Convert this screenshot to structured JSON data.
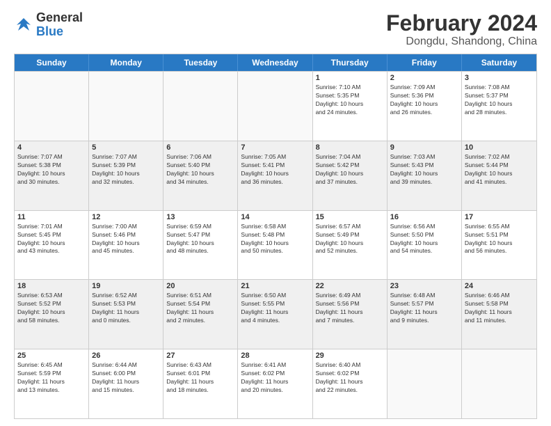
{
  "logo": {
    "text_general": "General",
    "text_blue": "Blue"
  },
  "header": {
    "month": "February 2024",
    "location": "Dongdu, Shandong, China"
  },
  "weekdays": [
    "Sunday",
    "Monday",
    "Tuesday",
    "Wednesday",
    "Thursday",
    "Friday",
    "Saturday"
  ],
  "rows": [
    [
      {
        "day": "",
        "text": "",
        "empty": true
      },
      {
        "day": "",
        "text": "",
        "empty": true
      },
      {
        "day": "",
        "text": "",
        "empty": true
      },
      {
        "day": "",
        "text": "",
        "empty": true
      },
      {
        "day": "1",
        "text": "Sunrise: 7:10 AM\nSunset: 5:35 PM\nDaylight: 10 hours\nand 24 minutes."
      },
      {
        "day": "2",
        "text": "Sunrise: 7:09 AM\nSunset: 5:36 PM\nDaylight: 10 hours\nand 26 minutes."
      },
      {
        "day": "3",
        "text": "Sunrise: 7:08 AM\nSunset: 5:37 PM\nDaylight: 10 hours\nand 28 minutes."
      }
    ],
    [
      {
        "day": "4",
        "text": "Sunrise: 7:07 AM\nSunset: 5:38 PM\nDaylight: 10 hours\nand 30 minutes.",
        "shaded": true
      },
      {
        "day": "5",
        "text": "Sunrise: 7:07 AM\nSunset: 5:39 PM\nDaylight: 10 hours\nand 32 minutes.",
        "shaded": true
      },
      {
        "day": "6",
        "text": "Sunrise: 7:06 AM\nSunset: 5:40 PM\nDaylight: 10 hours\nand 34 minutes.",
        "shaded": true
      },
      {
        "day": "7",
        "text": "Sunrise: 7:05 AM\nSunset: 5:41 PM\nDaylight: 10 hours\nand 36 minutes.",
        "shaded": true
      },
      {
        "day": "8",
        "text": "Sunrise: 7:04 AM\nSunset: 5:42 PM\nDaylight: 10 hours\nand 37 minutes.",
        "shaded": true
      },
      {
        "day": "9",
        "text": "Sunrise: 7:03 AM\nSunset: 5:43 PM\nDaylight: 10 hours\nand 39 minutes.",
        "shaded": true
      },
      {
        "day": "10",
        "text": "Sunrise: 7:02 AM\nSunset: 5:44 PM\nDaylight: 10 hours\nand 41 minutes.",
        "shaded": true
      }
    ],
    [
      {
        "day": "11",
        "text": "Sunrise: 7:01 AM\nSunset: 5:45 PM\nDaylight: 10 hours\nand 43 minutes."
      },
      {
        "day": "12",
        "text": "Sunrise: 7:00 AM\nSunset: 5:46 PM\nDaylight: 10 hours\nand 45 minutes."
      },
      {
        "day": "13",
        "text": "Sunrise: 6:59 AM\nSunset: 5:47 PM\nDaylight: 10 hours\nand 48 minutes."
      },
      {
        "day": "14",
        "text": "Sunrise: 6:58 AM\nSunset: 5:48 PM\nDaylight: 10 hours\nand 50 minutes."
      },
      {
        "day": "15",
        "text": "Sunrise: 6:57 AM\nSunset: 5:49 PM\nDaylight: 10 hours\nand 52 minutes."
      },
      {
        "day": "16",
        "text": "Sunrise: 6:56 AM\nSunset: 5:50 PM\nDaylight: 10 hours\nand 54 minutes."
      },
      {
        "day": "17",
        "text": "Sunrise: 6:55 AM\nSunset: 5:51 PM\nDaylight: 10 hours\nand 56 minutes."
      }
    ],
    [
      {
        "day": "18",
        "text": "Sunrise: 6:53 AM\nSunset: 5:52 PM\nDaylight: 10 hours\nand 58 minutes.",
        "shaded": true
      },
      {
        "day": "19",
        "text": "Sunrise: 6:52 AM\nSunset: 5:53 PM\nDaylight: 11 hours\nand 0 minutes.",
        "shaded": true
      },
      {
        "day": "20",
        "text": "Sunrise: 6:51 AM\nSunset: 5:54 PM\nDaylight: 11 hours\nand 2 minutes.",
        "shaded": true
      },
      {
        "day": "21",
        "text": "Sunrise: 6:50 AM\nSunset: 5:55 PM\nDaylight: 11 hours\nand 4 minutes.",
        "shaded": true
      },
      {
        "day": "22",
        "text": "Sunrise: 6:49 AM\nSunset: 5:56 PM\nDaylight: 11 hours\nand 7 minutes.",
        "shaded": true
      },
      {
        "day": "23",
        "text": "Sunrise: 6:48 AM\nSunset: 5:57 PM\nDaylight: 11 hours\nand 9 minutes.",
        "shaded": true
      },
      {
        "day": "24",
        "text": "Sunrise: 6:46 AM\nSunset: 5:58 PM\nDaylight: 11 hours\nand 11 minutes.",
        "shaded": true
      }
    ],
    [
      {
        "day": "25",
        "text": "Sunrise: 6:45 AM\nSunset: 5:59 PM\nDaylight: 11 hours\nand 13 minutes."
      },
      {
        "day": "26",
        "text": "Sunrise: 6:44 AM\nSunset: 6:00 PM\nDaylight: 11 hours\nand 15 minutes."
      },
      {
        "day": "27",
        "text": "Sunrise: 6:43 AM\nSunset: 6:01 PM\nDaylight: 11 hours\nand 18 minutes."
      },
      {
        "day": "28",
        "text": "Sunrise: 6:41 AM\nSunset: 6:02 PM\nDaylight: 11 hours\nand 20 minutes."
      },
      {
        "day": "29",
        "text": "Sunrise: 6:40 AM\nSunset: 6:02 PM\nDaylight: 11 hours\nand 22 minutes."
      },
      {
        "day": "",
        "text": "",
        "empty": true
      },
      {
        "day": "",
        "text": "",
        "empty": true
      }
    ]
  ]
}
